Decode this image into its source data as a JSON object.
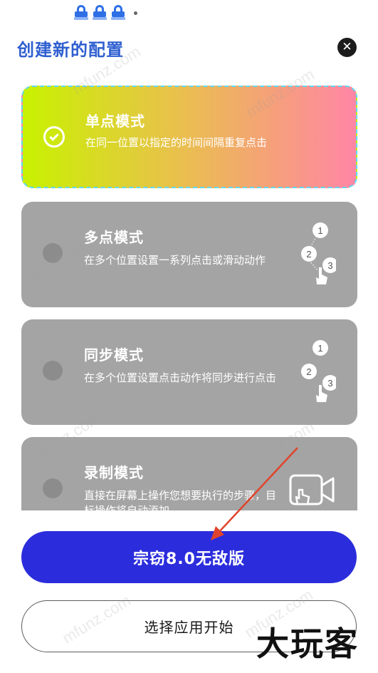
{
  "header": {
    "title": "创建新的配置",
    "close_icon": "close-icon"
  },
  "modes": [
    {
      "title": "单点模式",
      "desc": "在同一位置以指定的时间间隔重复点击",
      "selected": true
    },
    {
      "title": "多点模式",
      "desc": "在多个位置设置一系列点击或滑动动作",
      "selected": false,
      "icon": "multi-point-icon",
      "steps": [
        "1",
        "2",
        "3"
      ]
    },
    {
      "title": "同步模式",
      "desc": "在多个位置设置点击动作将同步进行点击",
      "selected": false,
      "icon": "sync-point-icon",
      "steps": [
        "1",
        "2",
        "3"
      ]
    },
    {
      "title": "录制模式",
      "desc": "直接在屏幕上操作您想要执行的步骤，目标操作将自动添加",
      "selected": false,
      "icon": "record-icon"
    }
  ],
  "buttons": {
    "primary": "宗窃8.0无敌版",
    "secondary": "选择应用开始"
  },
  "watermark": {
    "site": "mfunz.com",
    "logo": "大玩客"
  },
  "colors": {
    "accent": "#2b2ddc",
    "title": "#2f5fd0",
    "card_gray": "#a4a4a4",
    "arrow": "#e0442c"
  }
}
